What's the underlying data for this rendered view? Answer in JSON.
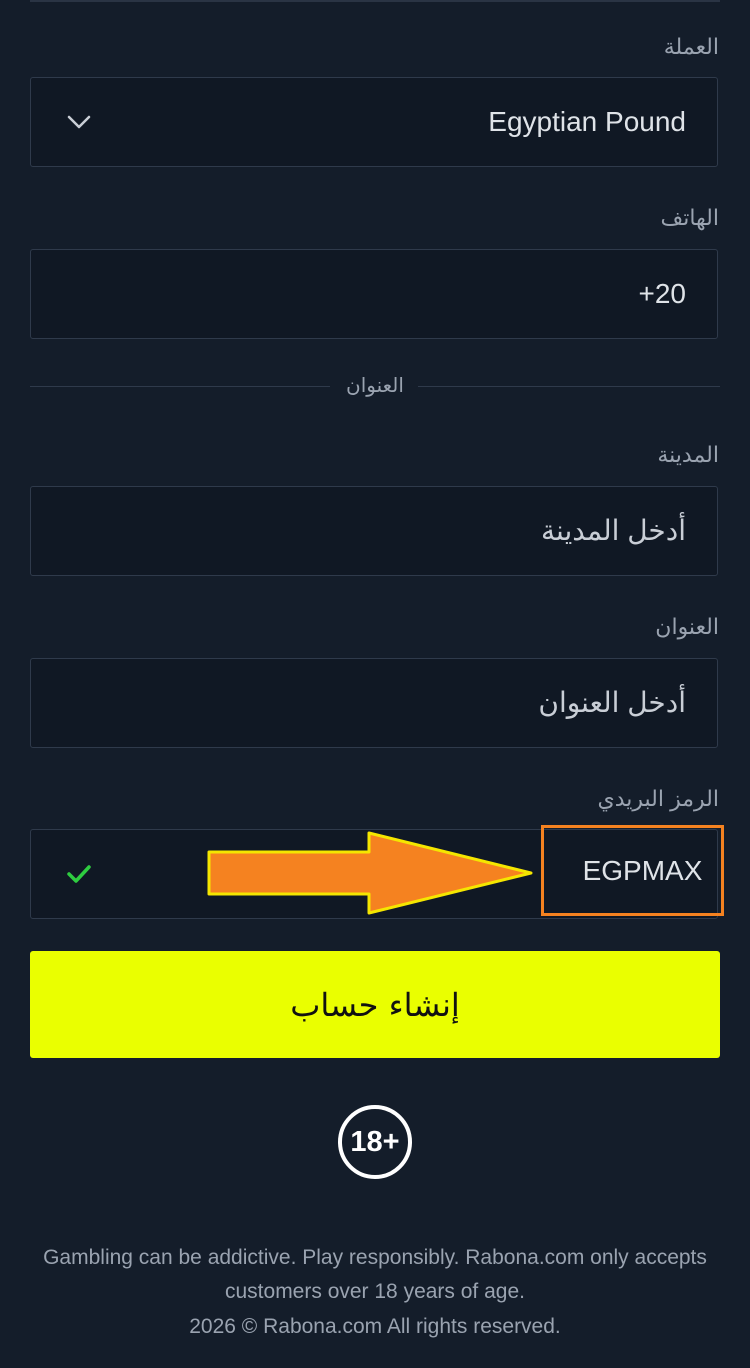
{
  "form": {
    "currency": {
      "label": "العملة",
      "value": "Egyptian Pound"
    },
    "phone": {
      "label": "الهاتف",
      "value": "+20"
    },
    "address_section": {
      "heading": "العنوان"
    },
    "city": {
      "label": "المدينة",
      "placeholder": "أدخل المدينة"
    },
    "address": {
      "label": "العنوان",
      "placeholder": "أدخل العنوان"
    },
    "promo": {
      "label": "الرمز البريدي",
      "value": "EGPMAX",
      "valid": true
    },
    "submit_label": "إنشاء حساب"
  },
  "age_badge": "18+",
  "footer": {
    "disclaimer": "Gambling can be addictive. Play responsibly. Rabona.com only accepts customers over 18 years of age.",
    "copyright": "2026 © Rabona.com All rights reserved."
  },
  "colors": {
    "background": "#141d2a",
    "field_bg": "#101824",
    "accent_yellow": "#eaff00",
    "highlight_orange": "#f58220",
    "check_green": "#2ecc40"
  },
  "icons": {
    "currency_dropdown": "chevron-down-icon",
    "promo_status": "checkmark-icon",
    "annotation": "arrow-right-icon"
  }
}
